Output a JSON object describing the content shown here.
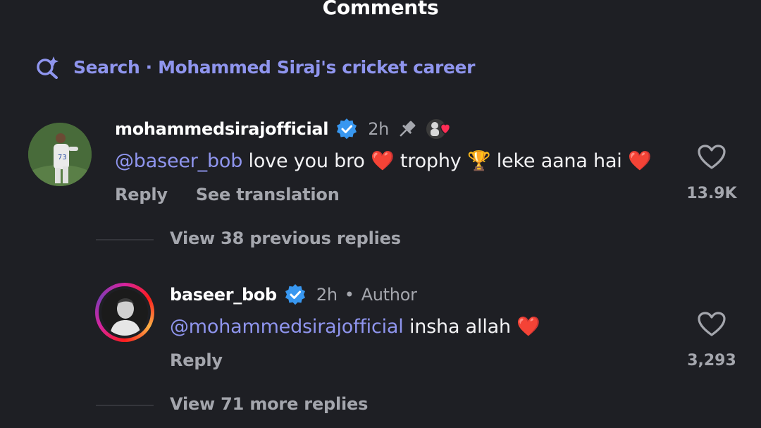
{
  "header": {
    "title": "Comments"
  },
  "search": {
    "label": "Search · Mohammed Siraj's cricket career"
  },
  "comment": {
    "username": "mohammedsirajofficial",
    "time": "2h",
    "mention": "@baseer_bob",
    "text": " love you bro ",
    "text2": " trophy ",
    "text3": " leke aana hai ",
    "heart_emoji": "❤️",
    "trophy_emoji": "🏆",
    "reply_label": "Reply",
    "translate_label": "See translation",
    "like_count": "13.9K",
    "view_previous": "View 38 previous replies"
  },
  "reply": {
    "username": "baseer_bob",
    "time": "2h",
    "dot": "•",
    "author_label": "Author",
    "mention": "@mohammedsirajofficial",
    "text": " insha allah ",
    "heart_emoji": "❤️",
    "reply_label": "Reply",
    "like_count": "3,293",
    "view_more": "View 71 more replies"
  },
  "colors": {
    "background": "#1e1f24",
    "accent": "#8f95ee",
    "verified": "#3897f0",
    "muted": "#a4a6ad"
  },
  "icons": [
    "search-sparkle-icon",
    "verified-badge-icon",
    "pin-icon",
    "heart-outline-icon",
    "liked-by-creator-icon"
  ]
}
